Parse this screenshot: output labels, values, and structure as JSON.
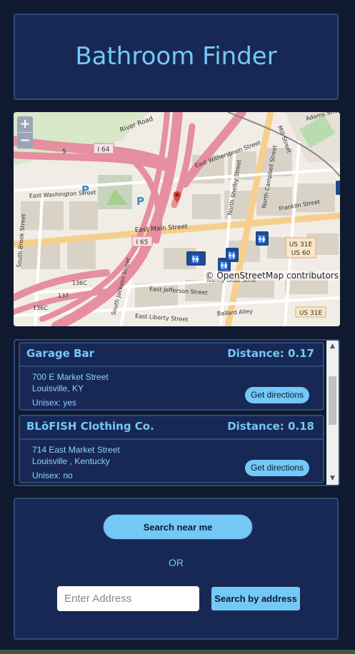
{
  "app": {
    "title": "Bathroom Finder"
  },
  "map": {
    "zoom_in": "+",
    "zoom_out": "−",
    "attribution": "© OpenStreetMap contributors",
    "labels": {
      "river_road": "River Road",
      "i64": "I 64",
      "i65": "I 65",
      "east_washington": "East Washington Street",
      "east_main": "East Main Street",
      "east_jefferson": "East Jefferson Street",
      "east_liberty": "East Liberty Street",
      "south_jackson": "South Jackson Street",
      "south_brook": "South Brook Street",
      "east_witherspoon": "East Witherspoon Street",
      "franklin": "Franklin Street",
      "nanny_goat": "Nanny Goat Strut",
      "ballard": "Ballard Alley",
      "us31e": "US 31E",
      "us60": "US 60",
      "adams": "Adams Street",
      "mill": "Mill Street",
      "north_shelby": "North Shelby Street",
      "north_campbell": "North Campbell Street",
      "r136c": "136C",
      "r137": "137",
      "r5": "5",
      "parking": "P"
    }
  },
  "results": [
    {
      "name": "Garage Bar",
      "distance": "Distance: 0.17",
      "street": "700 E Market Street",
      "city": "Louisville, KY",
      "unisex": "Unisex: yes",
      "directions_label": "Get directions"
    },
    {
      "name": "BLōFISH Clothing Co.",
      "distance": "Distance: 0.18",
      "street": "714 East Market Street",
      "city": "Louisville , Kentucky",
      "unisex": "Unisex: no",
      "directions_label": "Get directions"
    }
  ],
  "search": {
    "near_me_label": "Search near me",
    "or_label": "OR",
    "address_placeholder": "Enter Address",
    "address_value": "",
    "address_button_label": "Search by address"
  },
  "colors": {
    "background": "#0f1a30",
    "panel": "#172855",
    "border": "#2f4a78",
    "accent": "#74c8f6",
    "marker": "#d9473a",
    "toilet_icon": "#1f4a8c"
  }
}
